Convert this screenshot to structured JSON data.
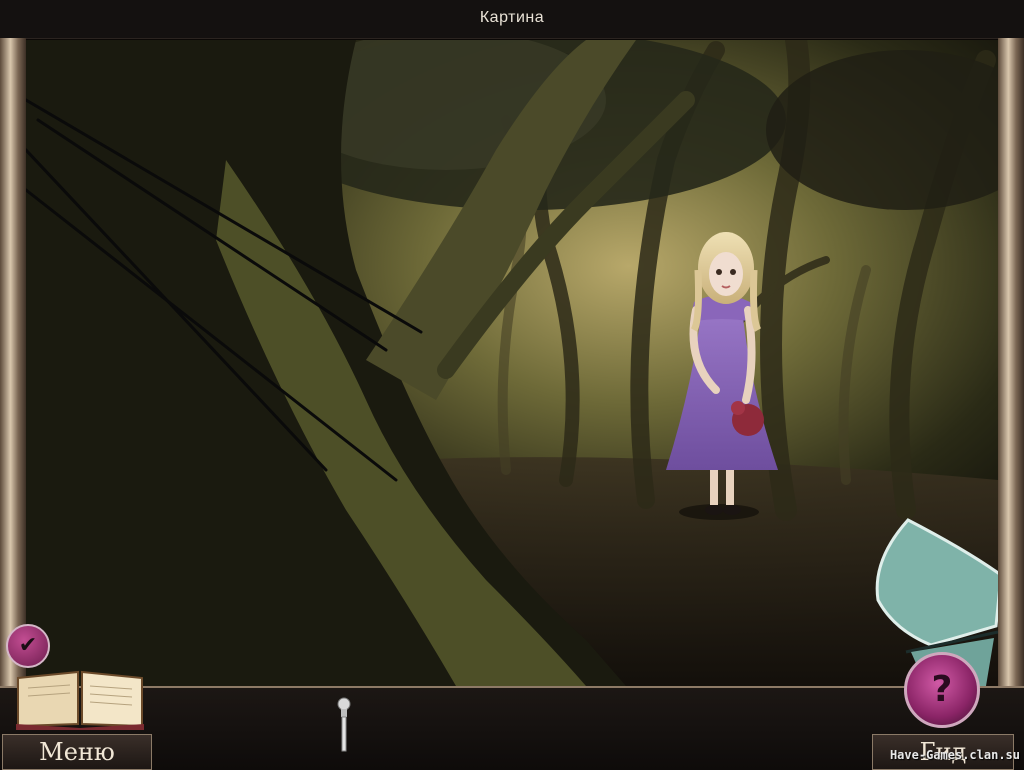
{
  "header": {
    "title": "Картина"
  },
  "hud": {
    "menu_label": "Меню",
    "guide_label": "Гид",
    "hint_symbol": "?",
    "check_symbol": "✔"
  },
  "inventory": {
    "items": [
      {
        "name": "silver-scepter",
        "icon": "scepter-icon"
      }
    ]
  },
  "watermark": "Have-Games.clan.su",
  "colors": {
    "accent_magenta": "#9b2c74",
    "frame_ivory": "#d9c7ad",
    "hud_dark": "#141110",
    "shard_teal": "#7fb3a9"
  }
}
